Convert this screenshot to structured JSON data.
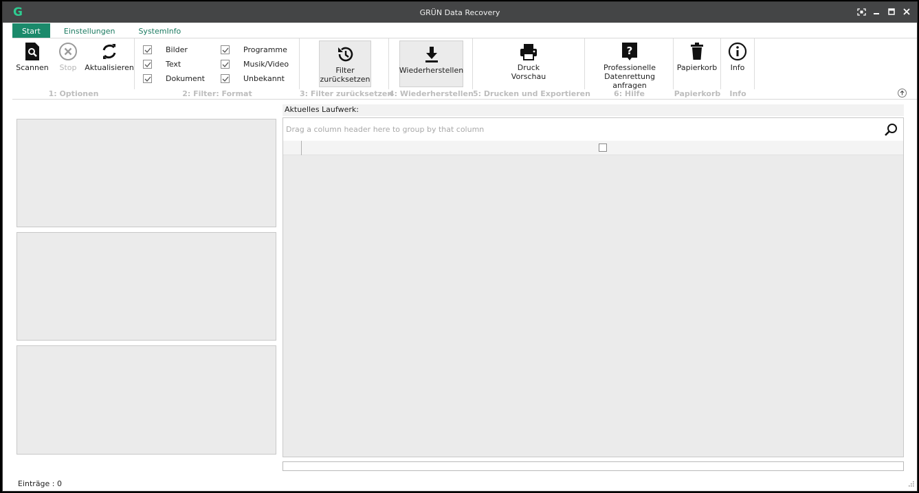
{
  "window": {
    "title": "GRÜN Data Recovery",
    "logo_letter": "G"
  },
  "tabs": [
    {
      "label": "Start",
      "active": true
    },
    {
      "label": "Einstellungen",
      "active": false
    },
    {
      "label": "SystemInfo",
      "active": false
    }
  ],
  "ribbon": {
    "options": {
      "scan": "Scannen",
      "stop": "Stop",
      "refresh": "Aktualisieren",
      "group_label": "1: Optionen"
    },
    "filter_format": {
      "group_label": "2: Filter: Format",
      "checks": [
        {
          "label": "Bilder",
          "checked": true
        },
        {
          "label": "Text",
          "checked": true
        },
        {
          "label": "Dokument",
          "checked": true
        },
        {
          "label": "Programme",
          "checked": true
        },
        {
          "label": "Musik/Video",
          "checked": true
        },
        {
          "label": "Unbekannt",
          "checked": true
        }
      ]
    },
    "filter_reset": {
      "line1": "Filter",
      "line2": "zurücksetzen",
      "group_label": "3: Filter zurücksetzen"
    },
    "restore": {
      "label": "Wiederherstellen",
      "group_label": "4: Wiederherstellen"
    },
    "print": {
      "line1": "Druck",
      "line2": "Vorschau",
      "group_label": "5: Drucken und Exportieren"
    },
    "help": {
      "line1": "Professionelle",
      "line2": "Datenrettung anfragen",
      "group_label": "6: Hilfe"
    },
    "trash": {
      "label": "Papierkorb",
      "group_label": "Papierkorb"
    },
    "info": {
      "label": "Info",
      "group_label": "Info"
    }
  },
  "main": {
    "drive_label": "Aktuelles Laufwerk:",
    "group_hint": "Drag a column header here to group by that column"
  },
  "status": {
    "entries": "Einträge : 0"
  },
  "colors": {
    "accent": "#1b8a6b",
    "titlebar": "#444546",
    "logo": "#2ecc91"
  }
}
